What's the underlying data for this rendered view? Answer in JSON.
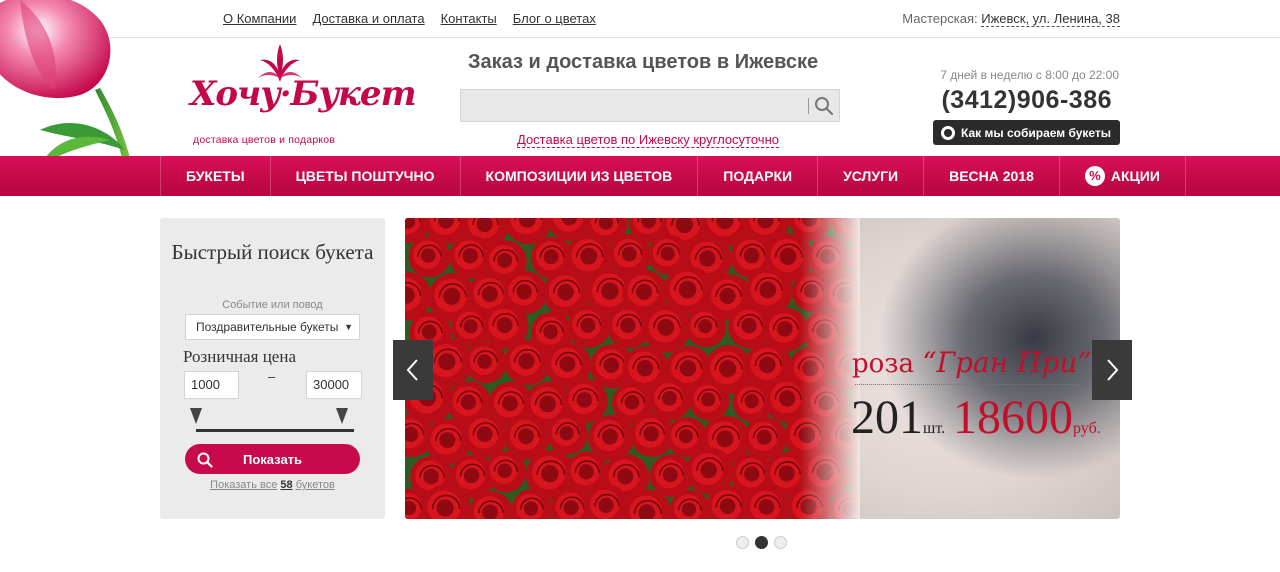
{
  "topbar": {
    "links": [
      "О Компании",
      "Доставка и оплата",
      "Контакты",
      "Блог о цветах"
    ],
    "workshop_label": "Мастерская:",
    "workshop_address": "Ижевск, ул. Ленина, 38"
  },
  "logo": {
    "name": "Хочу·Букет",
    "tagline": "доставка цветов и подарков"
  },
  "header": {
    "slogan": "Заказ и доставка цветов в Ижевске",
    "search_value": "",
    "delivery_link": "Доставка цветов по Ижевску круглосуточно",
    "hours": "7 дней в неделю с 8:00 до 22:00",
    "phone": "(3412)906-386",
    "how_button": "Как мы собираем букеты"
  },
  "nav": {
    "items": [
      "БУКЕТЫ",
      "ЦВЕТЫ ПОШТУЧНО",
      "КОМПОЗИЦИИ ИЗ ЦВЕТОВ",
      "ПОДАРКИ",
      "УСЛУГИ",
      "ВЕСНА 2018",
      "АКЦИИ"
    ],
    "promo_icon": "percent-icon"
  },
  "quick_search": {
    "title": "Быстрый поиск букета",
    "event_label": "Событие или повод",
    "event_selected": "Поздравительные букеты",
    "price_label": "Розничная цена",
    "price_from": "1000",
    "price_to": "30000",
    "range_separator": "–",
    "show_button": "Показать",
    "show_all_prefix": "Показать все",
    "show_all_count": "58",
    "show_all_suffix": "букетов"
  },
  "banner": {
    "rose_word": "роза",
    "rose_name": "“Гран При”",
    "count": "201",
    "count_unit": "шт.",
    "price": "18600",
    "price_unit": "руб."
  },
  "carousel": {
    "slides": 3,
    "active_index": 1
  },
  "colors": {
    "brand": "#c80a4c",
    "nav_top": "#d70f57",
    "nav_bottom": "#b8063f"
  }
}
